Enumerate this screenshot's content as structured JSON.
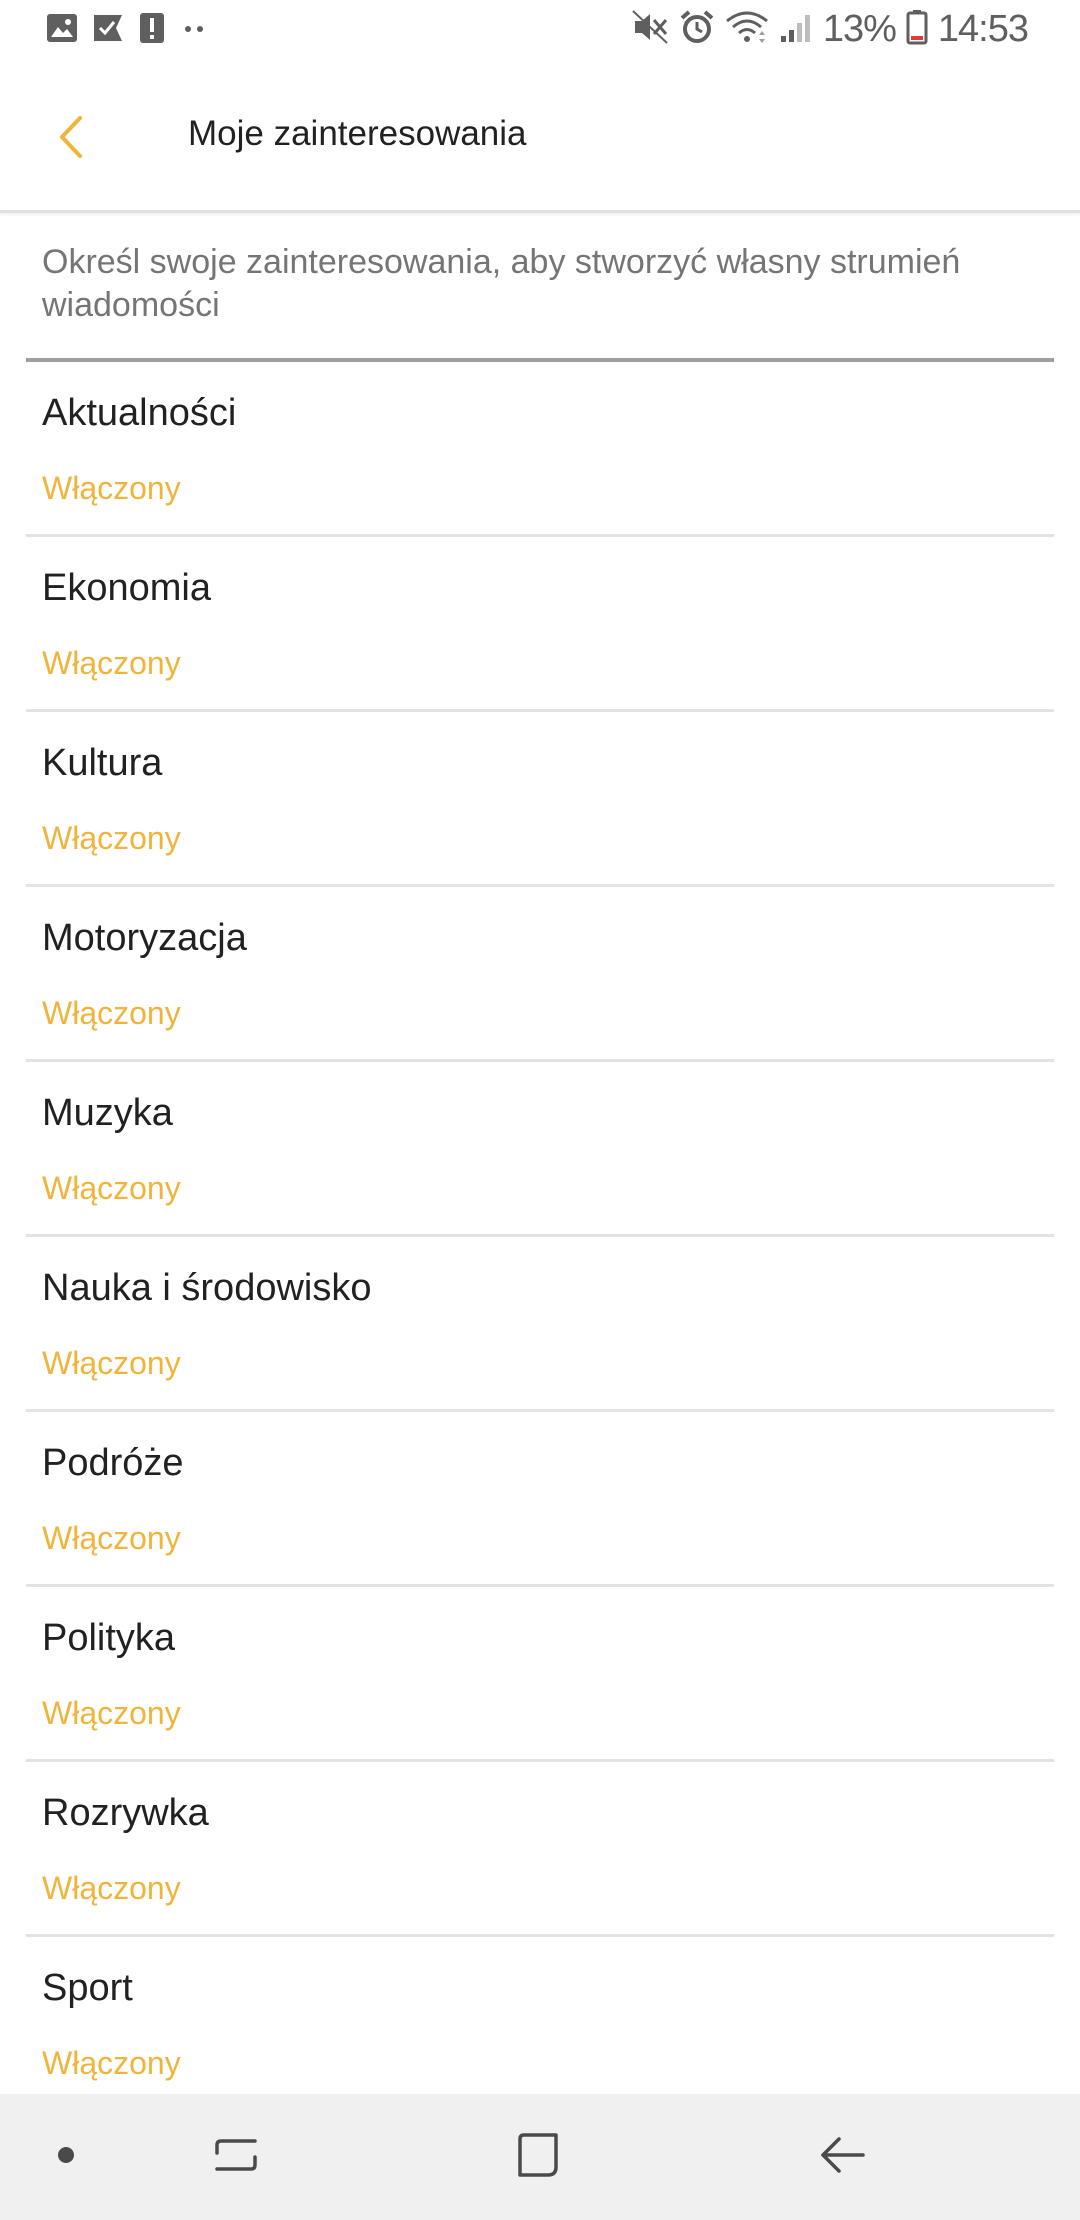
{
  "status_bar": {
    "battery_percent": "13%",
    "time": "14:53",
    "left_icons": [
      "gallery-icon",
      "check-flag-icon",
      "alert-icon",
      "more-dots-icon"
    ],
    "right_icons": [
      "mute-icon",
      "alarm-icon",
      "wifi-icon",
      "signal-icon",
      "battery-icon"
    ]
  },
  "header": {
    "title": "Moje zainteresowania",
    "back_icon": "chevron-left-icon"
  },
  "description": "Określ swoje zainteresowania, aby stworzyć własny strumień wiadomości",
  "interests": [
    {
      "name": "Aktualności",
      "status": "Włączony"
    },
    {
      "name": "Ekonomia",
      "status": "Włączony"
    },
    {
      "name": "Kultura",
      "status": "Włączony"
    },
    {
      "name": "Motoryzacja",
      "status": "Włączony"
    },
    {
      "name": "Muzyka",
      "status": "Włączony"
    },
    {
      "name": "Nauka i środowisko",
      "status": "Włączony"
    },
    {
      "name": "Podróże",
      "status": "Włączony"
    },
    {
      "name": "Polityka",
      "status": "Włączony"
    },
    {
      "name": "Rozrywka",
      "status": "Włączony"
    },
    {
      "name": "Sport",
      "status": "Włączony"
    }
  ],
  "nav_bar": {
    "items": [
      "dot-icon",
      "recent-apps-icon",
      "home-icon",
      "back-arrow-icon"
    ]
  },
  "colors": {
    "accent": "#f0b43b",
    "text_primary": "#212121",
    "text_secondary": "#757575",
    "divider": "#e3e3e3",
    "nav_bar_bg": "#f0f0f0"
  }
}
